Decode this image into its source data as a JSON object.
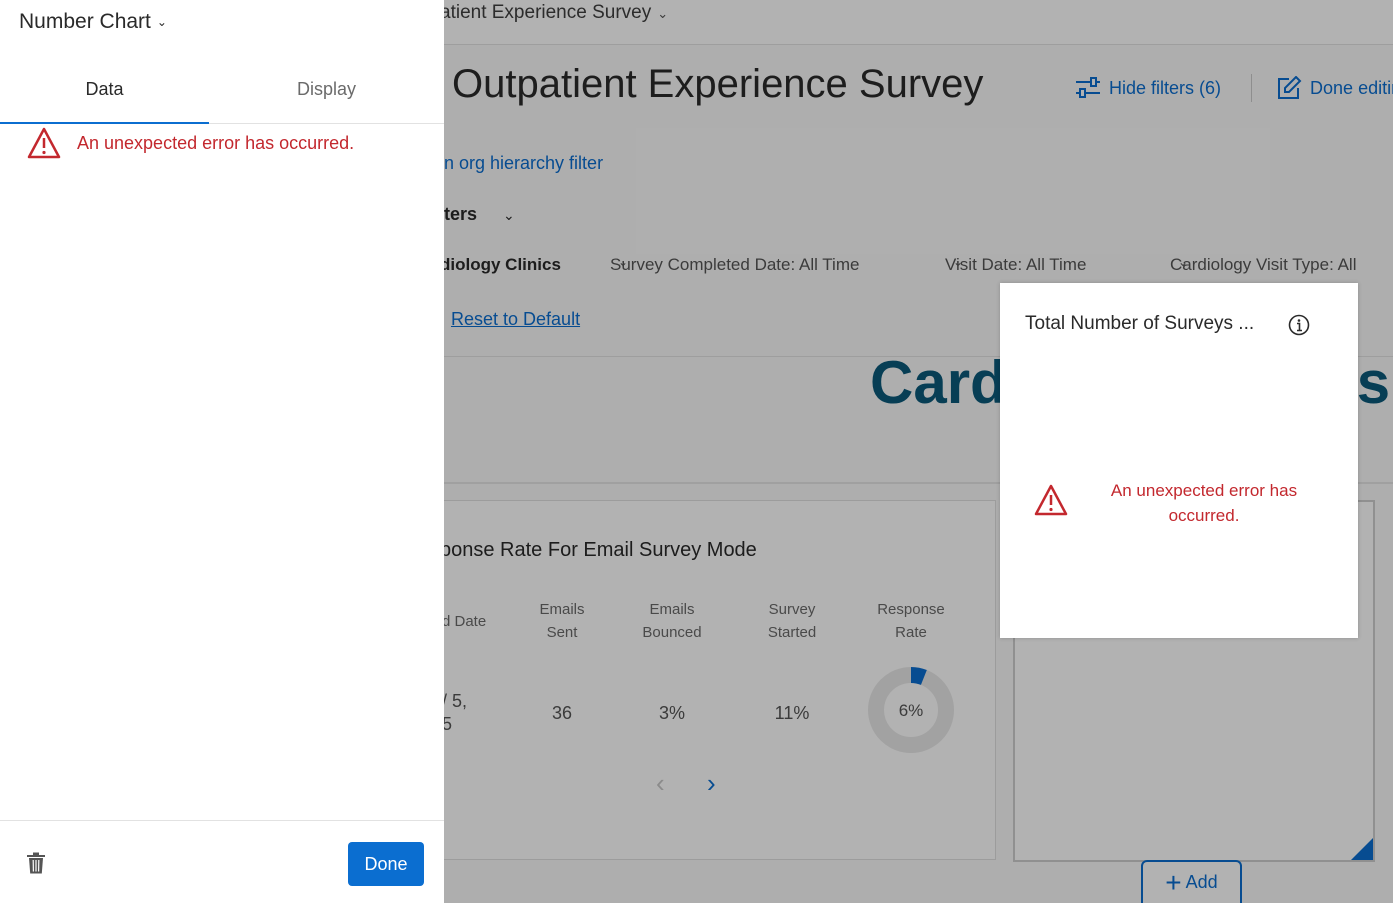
{
  "colors": {
    "accent": "#0b6ed0",
    "error": "#c3282e",
    "title_teal": "#0b5a7a"
  },
  "panel": {
    "title": "Number Chart",
    "tabs": [
      {
        "label": "Data"
      },
      {
        "label": "Display"
      }
    ],
    "error_message": "An unexpected error has occurred.",
    "done_label": "Done"
  },
  "dashboard": {
    "survey_select": "atient Experience Survey",
    "title": "Outpatient Experience Survey",
    "hide_filters": "Hide filters (6)",
    "done_editing": "Done editir",
    "org_link": "n org hierarchy filter",
    "filters_label": "ters",
    "filters": [
      {
        "label": "diology Clinics"
      },
      {
        "label": "Survey Completed Date: All Time"
      },
      {
        "label": "Visit Date: All Time"
      },
      {
        "label": "Cardiology Visit Type: All"
      }
    ],
    "reset_link": "Reset to Default",
    "big_title": "Card                     s",
    "widget": {
      "title": "ponse Rate For Email Survey Mode",
      "columns": [
        "d Date",
        "Emails Sent",
        "Emails Bounced",
        "Survey Started",
        "Response Rate"
      ],
      "row": {
        "date_line1": "/ 5,",
        "date_line2": "5",
        "emails_sent": "36",
        "emails_bounced": "3%",
        "survey_started": "11%",
        "response_rate": "6%"
      },
      "response_rate_fraction": 0.06
    },
    "add_label": "Add"
  },
  "popup": {
    "title": "Total Number of Surveys ...",
    "error_message": "An unexpected error has occurred."
  }
}
